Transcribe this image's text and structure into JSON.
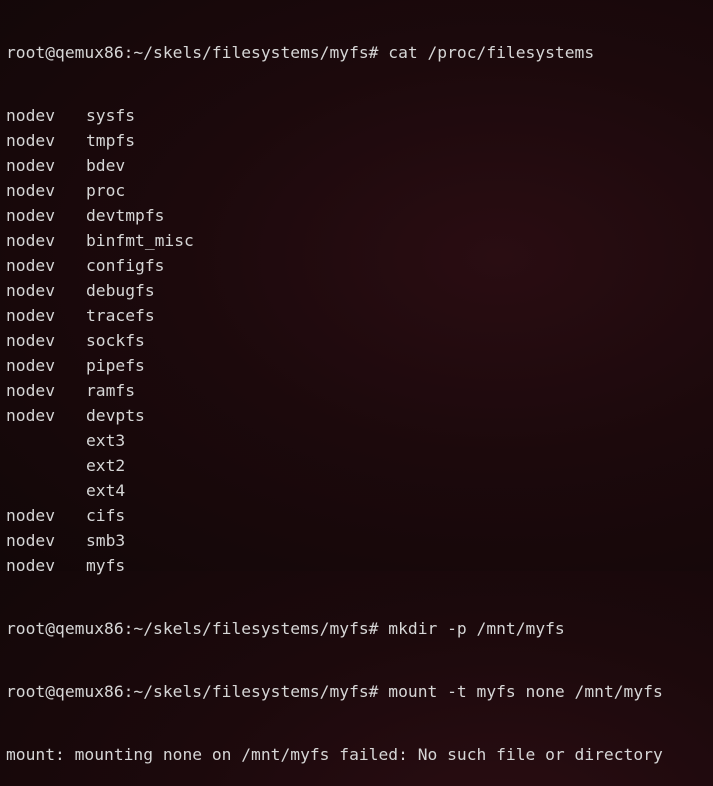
{
  "terminal": {
    "colors": {
      "background": "#1a0a0c",
      "text": "#d6d6d6"
    },
    "prompt": "root@qemux86:~/skels/filesystems/myfs# ",
    "cmd1": "cat /proc/filesystems",
    "filesystems": [
      {
        "flag": "nodev",
        "name": "sysfs"
      },
      {
        "flag": "nodev",
        "name": "tmpfs"
      },
      {
        "flag": "nodev",
        "name": "bdev"
      },
      {
        "flag": "nodev",
        "name": "proc"
      },
      {
        "flag": "nodev",
        "name": "devtmpfs"
      },
      {
        "flag": "nodev",
        "name": "binfmt_misc"
      },
      {
        "flag": "nodev",
        "name": "configfs"
      },
      {
        "flag": "nodev",
        "name": "debugfs"
      },
      {
        "flag": "nodev",
        "name": "tracefs"
      },
      {
        "flag": "nodev",
        "name": "sockfs"
      },
      {
        "flag": "nodev",
        "name": "pipefs"
      },
      {
        "flag": "nodev",
        "name": "ramfs"
      },
      {
        "flag": "nodev",
        "name": "devpts"
      },
      {
        "flag": "",
        "name": "ext3"
      },
      {
        "flag": "",
        "name": "ext2"
      },
      {
        "flag": "",
        "name": "ext4"
      },
      {
        "flag": "nodev",
        "name": "cifs"
      },
      {
        "flag": "nodev",
        "name": "smb3"
      },
      {
        "flag": "nodev",
        "name": "myfs"
      }
    ],
    "cmd2": "mkdir -p /mnt/myfs",
    "cmd3": "mount -t myfs none /mnt/myfs",
    "error": "mount: mounting none on /mnt/myfs failed: No such file or directory"
  }
}
